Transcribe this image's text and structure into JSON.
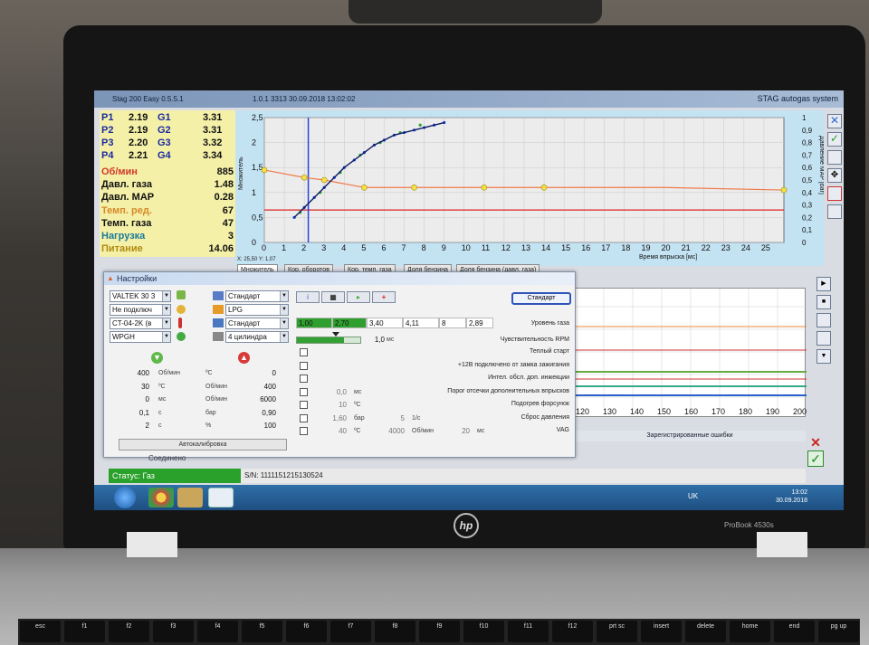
{
  "window": {
    "title": "Stag 200 Easy 0.5.5.1",
    "info": "1.0.1 3313   30.09.2018 13:02:02",
    "brand": "STAG autogas system"
  },
  "params": {
    "pressures": [
      {
        "p": "P1",
        "pv": "2.19",
        "g": "G1",
        "gv": "3.31"
      },
      {
        "p": "P2",
        "pv": "2.19",
        "g": "G2",
        "gv": "3.31"
      },
      {
        "p": "P3",
        "pv": "2.20",
        "g": "G3",
        "gv": "3.32"
      },
      {
        "p": "P4",
        "pv": "2.21",
        "g": "G4",
        "gv": "3.34"
      }
    ],
    "stats": [
      {
        "label": "Об/мин",
        "value": "885",
        "color": "#d2382a"
      },
      {
        "label": "Давл. газа",
        "value": "1.48",
        "color": "#111111"
      },
      {
        "label": "Давл. MAP",
        "value": "0.28",
        "color": "#111111"
      },
      {
        "label": "Темп. ред.",
        "value": "67",
        "color": "#d78a2a"
      },
      {
        "label": "Темп. газа",
        "value": "47",
        "color": "#111111"
      },
      {
        "label": "Нагрузка",
        "value": "3",
        "color": "#1a7a9a"
      },
      {
        "label": "Питание",
        "value": "14.06",
        "color": "#b08a10"
      }
    ]
  },
  "chart_data": {
    "type": "scatter",
    "xlabel": "Время впрыска [мс]",
    "ylabel": "Множитель",
    "y2label": "Давление MAP [bar]",
    "xlim": [
      0,
      26
    ],
    "ylim": [
      0,
      2.5
    ],
    "y2lim": [
      0,
      1
    ],
    "x_ticks": [
      0,
      1,
      2,
      3,
      4,
      5,
      6,
      7,
      8,
      9,
      10,
      11,
      12,
      13,
      14,
      15,
      16,
      17,
      18,
      19,
      20,
      21,
      22,
      23,
      24,
      25
    ],
    "y_ticks": [
      "0",
      "0,5",
      "1",
      "1,5",
      "2",
      "2,5"
    ],
    "y2_ticks": [
      "0",
      "0,1",
      "0,2",
      "0,3",
      "0,4",
      "0,5",
      "0,6",
      "0,7",
      "0,8",
      "0,9",
      "1"
    ],
    "cursor_readout": "X: 25,50  Y: 1,07",
    "multiplier_curve": [
      [
        0,
        1.45
      ],
      [
        2,
        1.3
      ],
      [
        3,
        1.25
      ],
      [
        5,
        1.1
      ],
      [
        7.5,
        1.1
      ],
      [
        11,
        1.1
      ],
      [
        14,
        1.1
      ],
      [
        20,
        1.1
      ],
      [
        26,
        1.05
      ]
    ],
    "multiplier_nodes": [
      [
        0,
        1.45
      ],
      [
        2,
        1.3
      ],
      [
        3,
        1.25
      ],
      [
        5,
        1.1
      ],
      [
        7.5,
        1.1
      ],
      [
        11,
        1.1
      ],
      [
        14,
        1.1
      ],
      [
        26,
        1.05
      ]
    ],
    "red_line_y": 0.65,
    "cursor_x": 2.2,
    "gas_points_blue": [
      [
        1.5,
        0.5
      ],
      [
        2,
        0.7
      ],
      [
        2.5,
        0.9
      ],
      [
        3,
        1.1
      ],
      [
        3.5,
        1.3
      ],
      [
        4,
        1.5
      ],
      [
        4.5,
        1.65
      ],
      [
        5,
        1.8
      ],
      [
        5.5,
        1.95
      ],
      [
        6,
        2.05
      ],
      [
        6.5,
        2.15
      ],
      [
        7,
        2.2
      ],
      [
        7.5,
        2.25
      ],
      [
        8,
        2.3
      ],
      [
        8.5,
        2.35
      ],
      [
        9,
        2.4
      ]
    ],
    "gas_points_green": [
      [
        1.8,
        0.6
      ],
      [
        2.8,
        1.0
      ],
      [
        3.8,
        1.4
      ],
      [
        4.8,
        1.75
      ],
      [
        5.8,
        2.0
      ],
      [
        6.8,
        2.2
      ],
      [
        7.8,
        2.35
      ]
    ]
  },
  "tabs": [
    "Множитель",
    "Кор. оборотов",
    "Кор. темп. газа",
    "Доля бензина",
    "Доля бензина (давл. газа)"
  ],
  "lower_graph": {
    "x_ticks": [
      "120",
      "130",
      "140",
      "150",
      "160",
      "170",
      "180",
      "190",
      "200"
    ],
    "errors_label": "Зарегистрированные ошибки"
  },
  "dialog": {
    "title": "Настройки",
    "combos_left": [
      "VALTEK 30 3",
      "Не подключ",
      "CT-04-2K (в",
      "WPGH"
    ],
    "combos_mid": [
      "Стандарт",
      "LPG",
      "Стандарт",
      "4 цилиндра"
    ],
    "standard_button": "Стандарт",
    "level_cells": [
      "1,00",
      "2,70",
      "3,40",
      "4,11",
      "8",
      "2,89"
    ],
    "level_label": "Уровень газа",
    "rpm_sens_value": "1,0",
    "rpm_sens_unit": "мс",
    "rpm_sens_label": "Чувствительность RPM",
    "left_values": [
      {
        "a": "400",
        "au": "Об/мин",
        "bu": "ºC",
        "b": "0"
      },
      {
        "a": "30",
        "au": "ºC",
        "bu": "Об/мин",
        "b": "400"
      },
      {
        "a": "0",
        "au": "мс",
        "bu": "Об/мин",
        "b": "6000"
      },
      {
        "a": "0,1",
        "au": "с",
        "bu": "бар",
        "b": "0,90"
      },
      {
        "a": "2",
        "au": "с",
        "bu": "%",
        "b": "100"
      }
    ],
    "options": [
      {
        "label": "Теплый старт",
        "value": "",
        "unit": ""
      },
      {
        "label": "+12В подключено от замка зажигания",
        "value": "",
        "unit": ""
      },
      {
        "label": "Интел. обсл. доп. инжекции",
        "value": "",
        "unit": ""
      },
      {
        "label": "Порог отсечки дополнительных впрысков",
        "value": "0,0",
        "unit": "мс"
      },
      {
        "label": "Подогрев форсунок",
        "value": "10",
        "unit": "ºC"
      },
      {
        "label": "Сброс давления",
        "value": "1,60",
        "unit": "бар",
        "value2": "5",
        "unit2": "1/с"
      },
      {
        "label": "VAG",
        "value": "40",
        "unit": "ºC",
        "value2": "4000",
        "unit2": "Об/мин",
        "value3": "20",
        "unit3": "мс"
      }
    ],
    "autocal_label": "Автокалибровка"
  },
  "status": {
    "connected": "Соединено",
    "state": "Статус: Газ",
    "serial": "S/N: 1111151215130524"
  },
  "taskbar": {
    "lang": "UK",
    "time": "13:02",
    "date": "30.09.2018"
  },
  "laptop": {
    "logo": "hp",
    "model": "ProBook 4530s",
    "keys": [
      "esc",
      "f1",
      "f2",
      "f3",
      "f4",
      "f5",
      "f6",
      "f7",
      "f8",
      "f9",
      "f10",
      "f11",
      "f12",
      "prt sc",
      "insert",
      "delete",
      "home",
      "end",
      "pg up"
    ]
  }
}
